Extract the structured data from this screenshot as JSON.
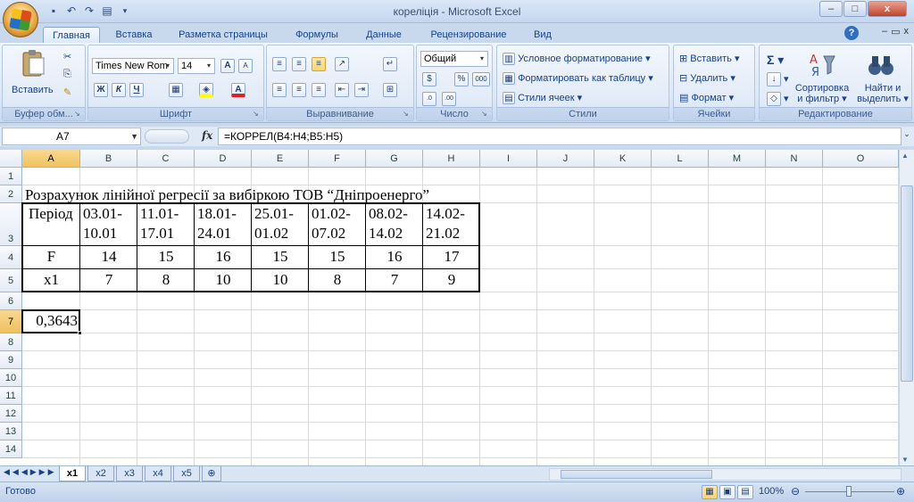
{
  "window": {
    "title": "кореліція - Microsoft Excel",
    "minimize": "–",
    "maximize": "□",
    "close": "x"
  },
  "qat": {
    "save_icon": "save-icon",
    "undo_icon": "undo-icon",
    "redo_icon": "redo-icon",
    "print_icon": "print-preview-icon"
  },
  "tabs": [
    {
      "label": "Главная"
    },
    {
      "label": "Вставка"
    },
    {
      "label": "Разметка страницы"
    },
    {
      "label": "Формулы"
    },
    {
      "label": "Данные"
    },
    {
      "label": "Рецензирование"
    },
    {
      "label": "Вид"
    }
  ],
  "ribbon": {
    "clipboard": {
      "label": "Буфер обм...",
      "paste": "Вставить"
    },
    "font": {
      "label": "Шрифт",
      "name": "Times New Rom",
      "size": "14",
      "bold": "Ж",
      "italic": "К",
      "underline": "Ч",
      "grow": "A",
      "shrink": "A"
    },
    "alignment": {
      "label": "Выравнивание"
    },
    "number": {
      "label": "Число",
      "format": "Общий",
      "percent": "%",
      "thousands": "000"
    },
    "styles": {
      "label": "Стили",
      "conditional": "Условное форматирование",
      "as_table": "Форматировать как таблицу",
      "cell_styles": "Стили ячеек"
    },
    "cells": {
      "label": "Ячейки",
      "insert": "Вставить",
      "delete": "Удалить",
      "format": "Формат"
    },
    "editing": {
      "label": "Редактирование",
      "sigma": "Σ",
      "sort_line1": "Сортировка",
      "sort_line2": "и фильтр",
      "find_line1": "Найти и",
      "find_line2": "выделить"
    }
  },
  "formula_bar": {
    "name_box": "A7",
    "fx": "fx",
    "formula": "=КОРРЕЛ(B4:H4;B5:H5)"
  },
  "columns": [
    "A",
    "B",
    "C",
    "D",
    "E",
    "F",
    "G",
    "H",
    "I",
    "J",
    "K",
    "L",
    "M",
    "N",
    "O"
  ],
  "rows": [
    "1",
    "2",
    "3",
    "4",
    "5",
    "6",
    "7",
    "8",
    "9",
    "10",
    "11",
    "12",
    "13",
    "14"
  ],
  "sheet": {
    "title": "Розрахунок лінійної регресії за вибіркою ТОВ “Дніпроенерго”",
    "period_label": "Період",
    "periods": [
      {
        "l1": "03.01-",
        "l2": "10.01"
      },
      {
        "l1": "11.01-",
        "l2": "17.01"
      },
      {
        "l1": "18.01-",
        "l2": "24.01"
      },
      {
        "l1": "25.01-",
        "l2": "01.02"
      },
      {
        "l1": "01.02-",
        "l2": "07.02"
      },
      {
        "l1": "08.02-",
        "l2": "14.02"
      },
      {
        "l1": "14.02-",
        "l2": "21.02"
      }
    ],
    "row4_label": "F",
    "row4": [
      "14",
      "15",
      "16",
      "15",
      "15",
      "16",
      "17"
    ],
    "row5_label": "x1",
    "row5": [
      "7",
      "8",
      "10",
      "10",
      "8",
      "7",
      "9"
    ],
    "result": "0,3643"
  },
  "sheet_tabs": [
    {
      "label": "x1"
    },
    {
      "label": "x2"
    },
    {
      "label": "x3"
    },
    {
      "label": "x4"
    },
    {
      "label": "x5"
    }
  ],
  "status": {
    "ready": "Готово",
    "zoom": "100%"
  }
}
